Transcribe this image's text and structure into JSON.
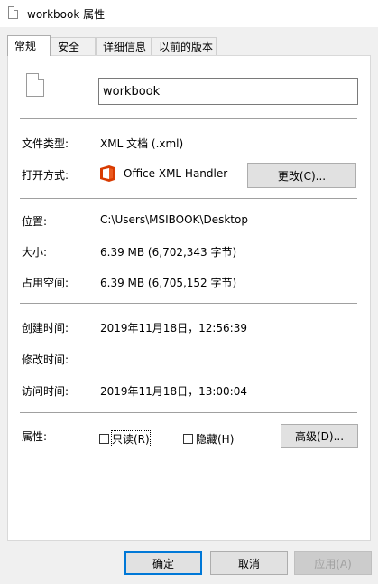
{
  "window": {
    "title": "workbook 属性"
  },
  "tabs": [
    {
      "label": "常规",
      "active": true
    },
    {
      "label": "安全"
    },
    {
      "label": "详细信息"
    },
    {
      "label": "以前的版本"
    }
  ],
  "general": {
    "file_name": "workbook",
    "file_type_label": "文件类型:",
    "file_type_value": "XML 文档 (.xml)",
    "open_with_label": "打开方式:",
    "open_with_value": "Office XML Handler",
    "open_with_icon": "office-logo-icon",
    "change_button": "更改(C)...",
    "location_label": "位置:",
    "location_value": "C:\\Users\\MSIBOOK\\Desktop",
    "size_label": "大小:",
    "size_value": "6.39 MB (6,702,343 字节)",
    "size_on_disk_label": "占用空间:",
    "size_on_disk_value": "6.39 MB (6,705,152 字节)",
    "created_label": "创建时间:",
    "created_value": "2019年11月18日，12:56:39",
    "modified_label": "修改时间:",
    "modified_value": "",
    "accessed_label": "访问时间:",
    "accessed_value": "2019年11月18日，13:00:04",
    "attributes_label": "属性:",
    "readonly_label": "只读(R)",
    "hidden_label": "隐藏(H)",
    "advanced_button": "高级(D)..."
  },
  "footer": {
    "ok_button": "确定",
    "cancel_button": "取消",
    "apply_button": "应用(A)"
  },
  "colors": {
    "accent": "#0078d7",
    "office": "#d83b01"
  }
}
